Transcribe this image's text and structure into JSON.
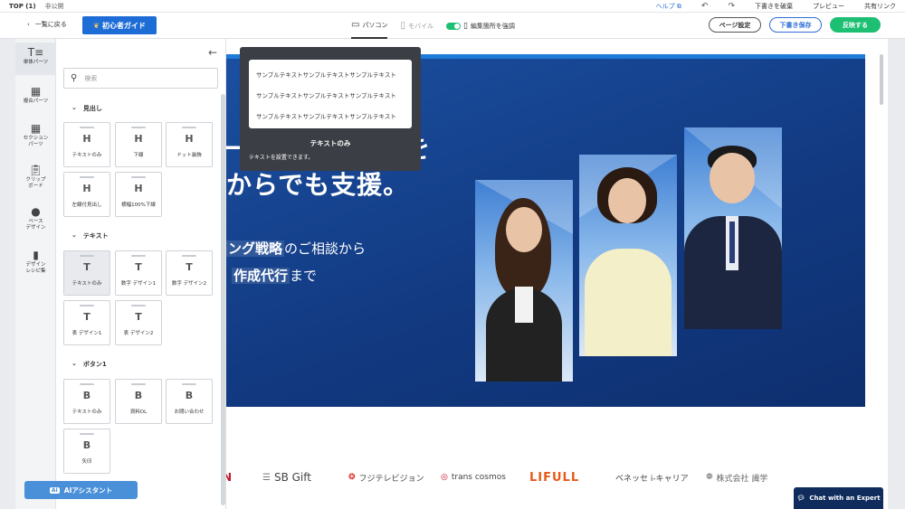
{
  "topbar": {
    "title": "TOP (1)",
    "status": "非公開",
    "help": "ヘルプ",
    "discard": "下書きを破棄",
    "preview": "プレビュー",
    "share": "共有リンク"
  },
  "toolbar": {
    "back": "一覧に戻る",
    "guide": "初心者ガイド",
    "devices": [
      {
        "label": "パソコン"
      },
      {
        "label": "モバイル"
      }
    ],
    "emphasize": "編集箇所を強調",
    "page_settings": "ページ設定",
    "save_draft": "下書き保存",
    "publish": "反映する"
  },
  "rail": [
    {
      "label1": "単体パーツ",
      "label2": ""
    },
    {
      "label1": "複合パーツ",
      "label2": ""
    },
    {
      "label1": "セクション",
      "label2": "パーツ"
    },
    {
      "label1": "クリップ",
      "label2": "ボード"
    },
    {
      "label1": "ベース",
      "label2": "デザイン"
    },
    {
      "label1": "デザイン",
      "label2": "レシピ集"
    }
  ],
  "panel": {
    "search_placeholder": "検索",
    "sections": [
      {
        "title": "見出し",
        "items": [
          {
            "icon": "H",
            "label": "テキストのみ"
          },
          {
            "icon": "H",
            "label": "下線"
          },
          {
            "icon": "H",
            "label": "ドット装飾"
          },
          {
            "icon": "H",
            "label": "左線付見出し"
          },
          {
            "icon": "H",
            "label": "横幅100%下線"
          }
        ]
      },
      {
        "title": "テキスト",
        "items": [
          {
            "icon": "T",
            "label": "テキストのみ"
          },
          {
            "icon": "T",
            "label": "数字 デザイン1"
          },
          {
            "icon": "T",
            "label": "数字 デザイン2"
          },
          {
            "icon": "T",
            "label": "表 デザイン1"
          },
          {
            "icon": "T",
            "label": "表 デザイン2"
          }
        ]
      },
      {
        "title": "ボタン1",
        "items": [
          {
            "icon": "B",
            "label": "テキストのみ"
          },
          {
            "icon": "B",
            "label": "資料DL"
          },
          {
            "icon": "B",
            "label": "お問い合わせ"
          },
          {
            "icon": "B",
            "label": "矢印"
          }
        ]
      }
    ],
    "ai_button": "AIアシスタント"
  },
  "tooltip": {
    "lines": [
      "サンプルテキストサンプルテキストサンプルテキスト",
      "サンプルテキストサンプルテキストサンプルテキスト",
      "サンプルテキストサンプルテキストサンプルテキスト"
    ],
    "name": "テキストのみ",
    "desc": "テキストを設置できます。"
  },
  "hero": {
    "line1": "ー",
    "line1_end": "を",
    "line2": "からでも支援。",
    "line3_hl": "ング戦略",
    "line3_rest": "のご相談から",
    "line4_hl": "作成代行",
    "line4_rest": "まで"
  },
  "logos": [
    "N",
    "SB Gift",
    "フジテレビジョン",
    "trans cosmos",
    "LIFULL",
    "ベネッセ i-キャリア",
    "株式会社 識学"
  ],
  "chat_button": "Chat with an Expert",
  "colors": {
    "brand_blue": "#1e6cd6",
    "publish_green": "#1dbf73",
    "hero_navy": "#123a82"
  }
}
